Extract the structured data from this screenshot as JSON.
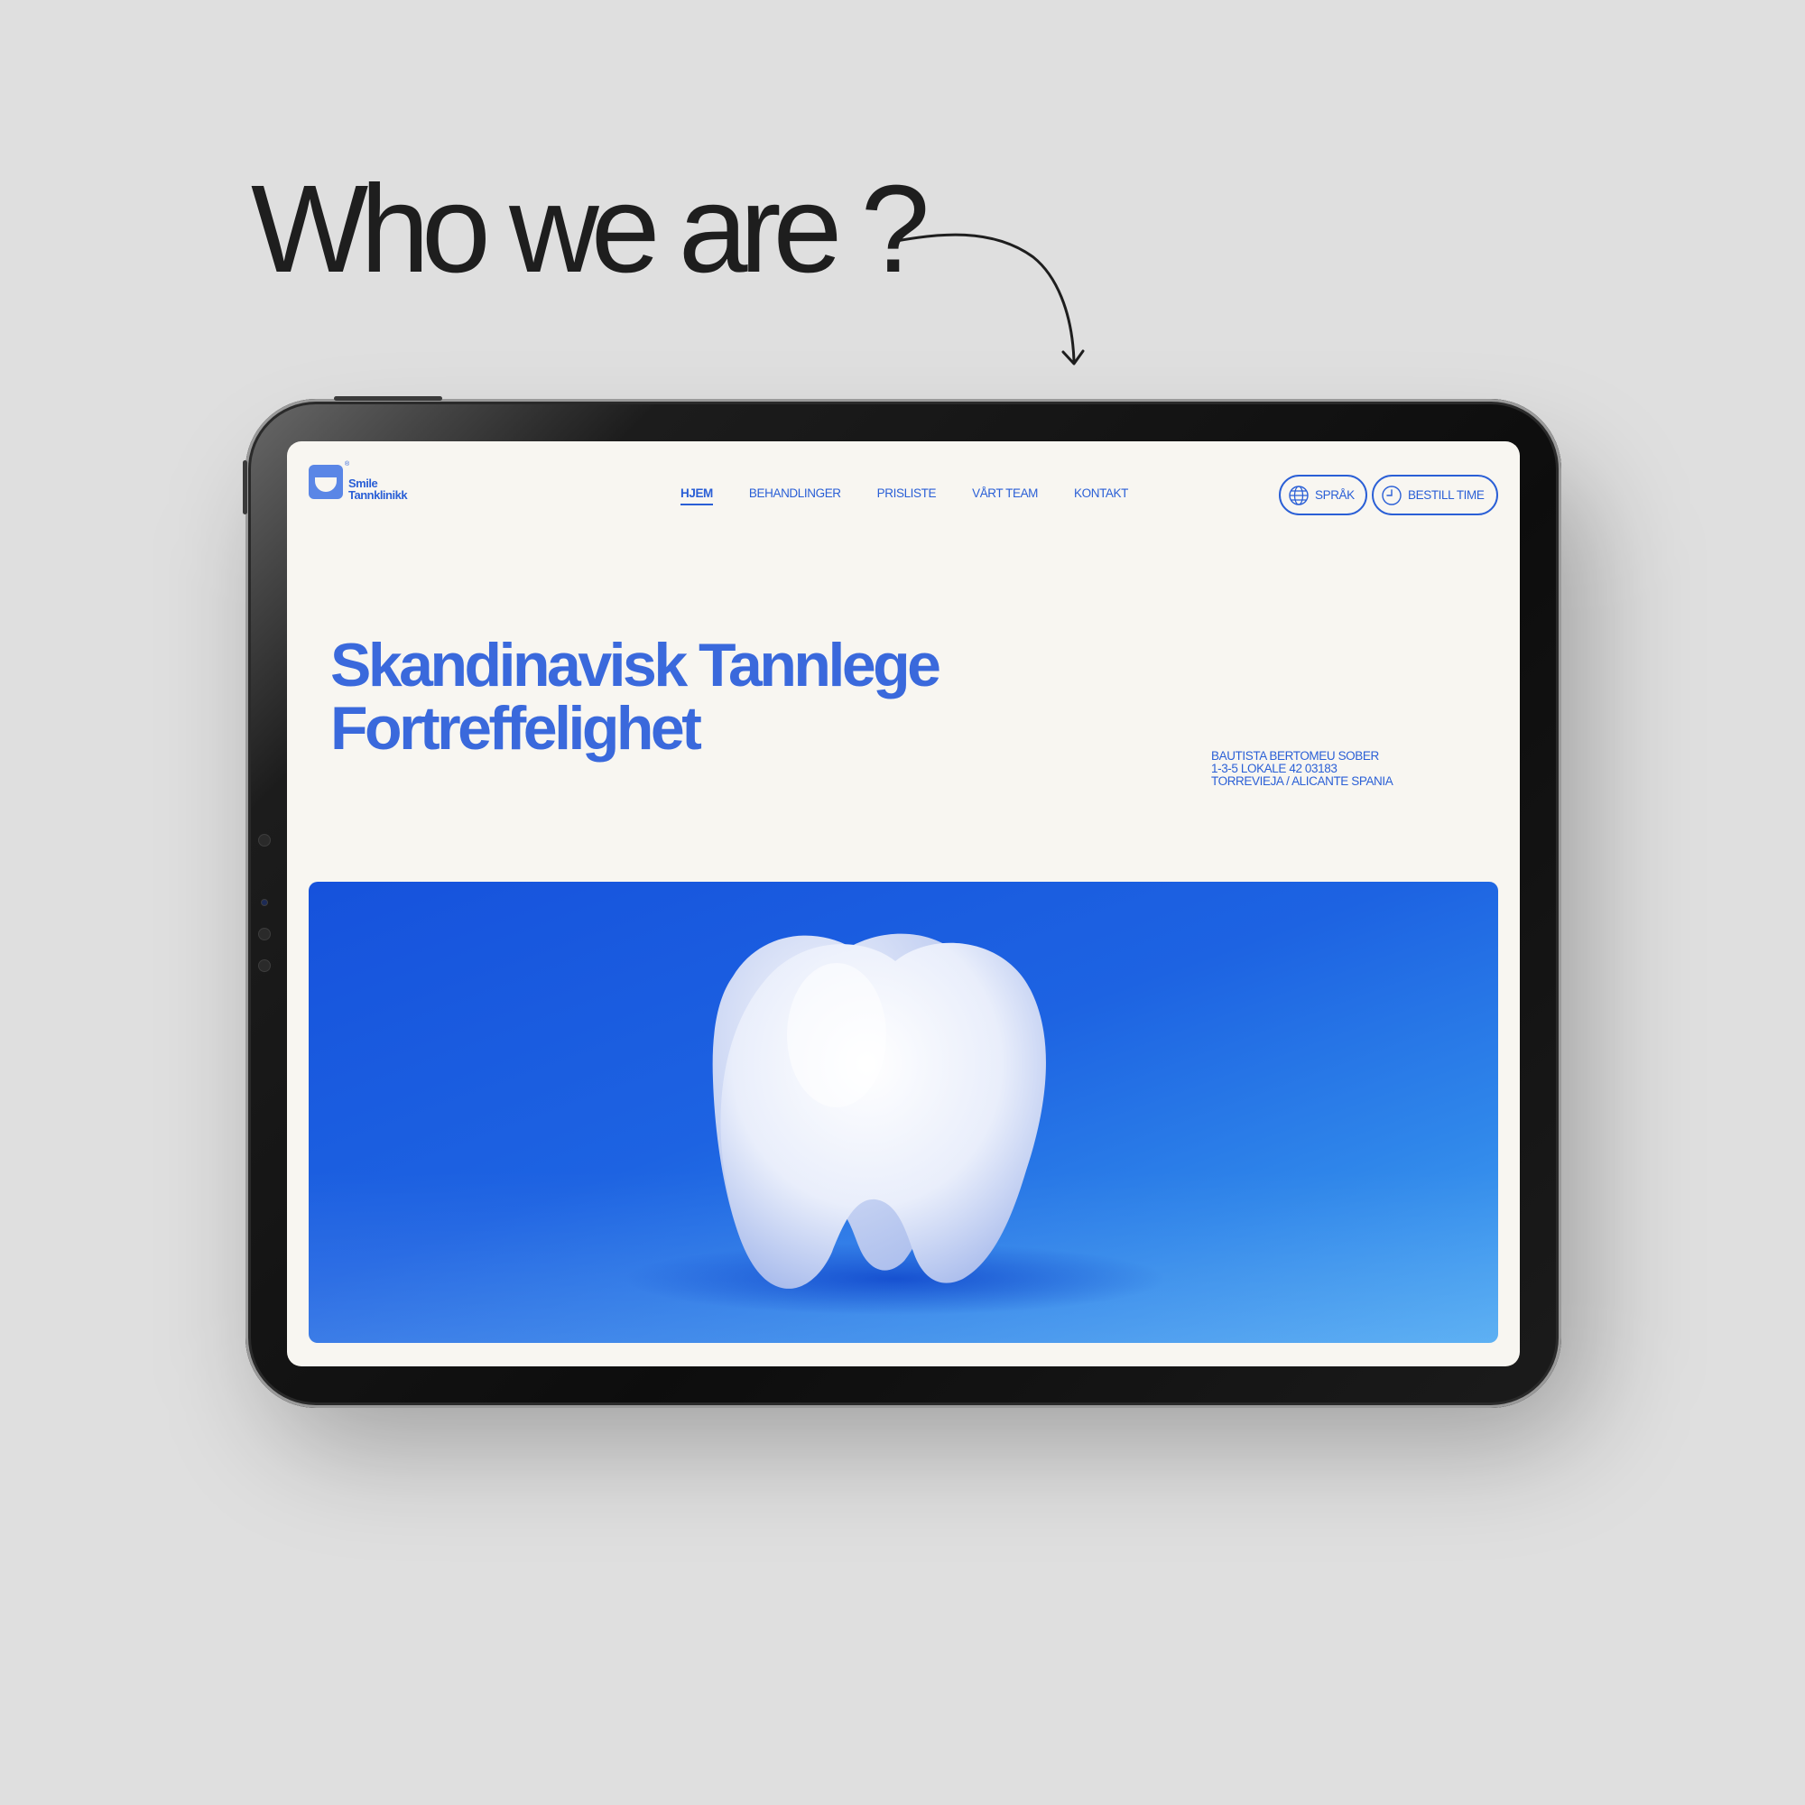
{
  "headline": "Who we are ?",
  "brand": {
    "name_line1": "Smile",
    "name_line2": "Tannklinikk",
    "reg": "®"
  },
  "nav": {
    "items": [
      {
        "label": "HJEM",
        "active": true
      },
      {
        "label": "BEHANDLINGER",
        "active": false
      },
      {
        "label": "PRISLISTE",
        "active": false
      },
      {
        "label": "VÅRT TEAM",
        "active": false
      },
      {
        "label": "KONTAKT",
        "active": false
      }
    ]
  },
  "actions": {
    "language_label": "SPRÅK",
    "book_label": "BESTILL TIME"
  },
  "hero": {
    "title_line1": "Skandinavisk Tannlege",
    "title_line2": "Fortreffelighet",
    "address_line1": "BAUTISTA BERTOMEU SOBER",
    "address_line2": "1-3-5 LOKALE 42 03183",
    "address_line3": "TORREVIEJA / ALICANTE SPANIA"
  },
  "colors": {
    "background": "#dfdfdf",
    "accent": "#2a5fd6",
    "screen_bg": "#f8f6f1",
    "hero_blue": "#1d63e2"
  },
  "icons": {
    "language": "globe-icon",
    "book": "clock-icon",
    "arrow": "curved-arrow-icon"
  }
}
